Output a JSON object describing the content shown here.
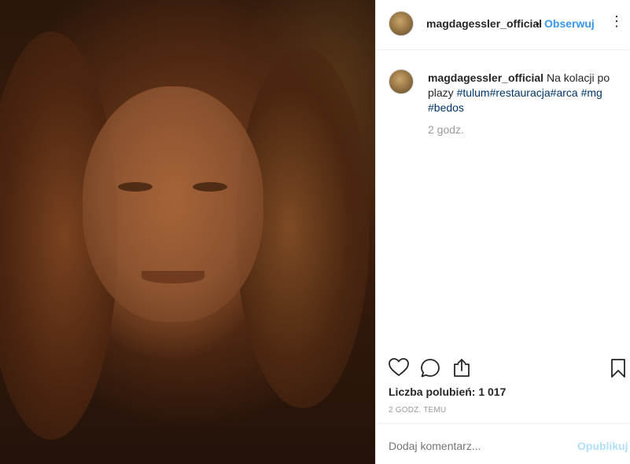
{
  "header": {
    "username": "magdagessler_official",
    "separator": "•",
    "follow_label": "Obserwuj",
    "more_label": "⋮"
  },
  "caption": {
    "username": "magdagessler_official",
    "text": "Na kolacji po plazy",
    "hashtags": [
      "#tulum",
      "#restauracja",
      "#arca",
      "#mg",
      "#bedos"
    ],
    "time": "2 godz."
  },
  "actions": {
    "icons": [
      "heart-icon",
      "comment-icon",
      "share-icon",
      "bookmark-icon"
    ]
  },
  "likes": "Liczba polubień: 1 017",
  "posted_ago": "2 godz. temu",
  "comment": {
    "placeholder": "Dodaj komentarz...",
    "post_label": "Opublikuj"
  },
  "colors": {
    "link": "#3897f0",
    "hashtag": "#003569",
    "muted": "#999999",
    "post_disabled": "#b2dffc"
  }
}
